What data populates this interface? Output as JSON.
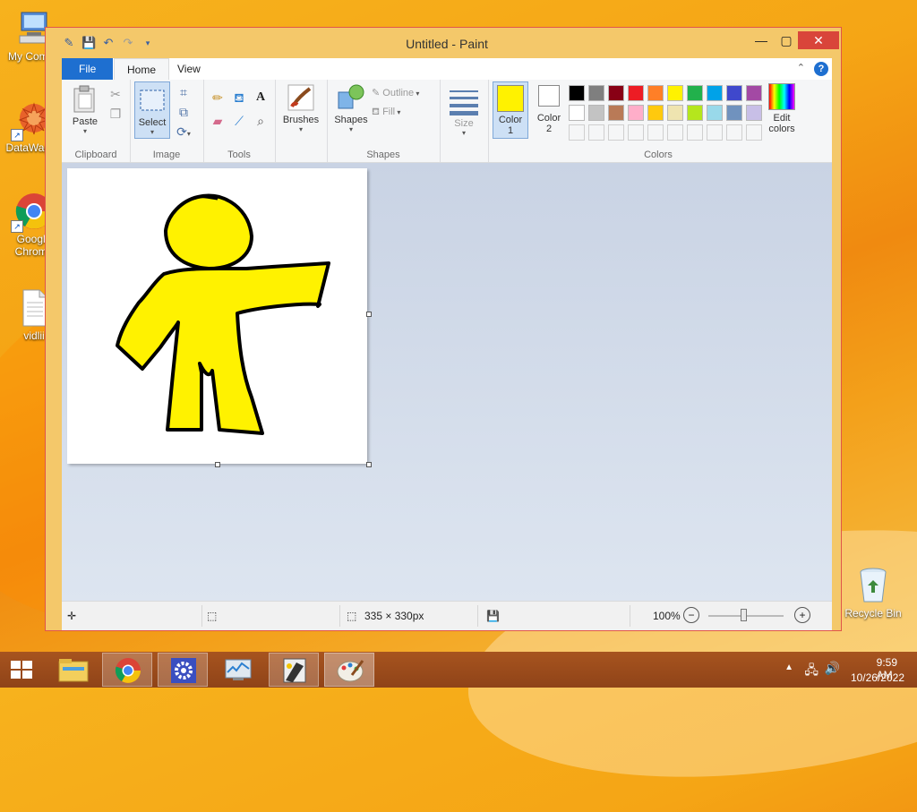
{
  "desktop": {
    "icons": [
      {
        "label": "My Compu",
        "icon": "computer-icon"
      },
      {
        "label": "DataWagon",
        "icon": "datawagon-icon"
      },
      {
        "label": "Google Chrome",
        "icon": "chrome-icon"
      },
      {
        "label": "vidlii",
        "icon": "text-file-icon"
      },
      {
        "label": "Recycle Bin",
        "icon": "recycle-bin-icon"
      }
    ]
  },
  "window": {
    "title": "Untitled - Paint",
    "controls": {
      "minimize": "—",
      "maximize": "▢",
      "close": "✕"
    }
  },
  "menu": {
    "file": "File",
    "home": "Home",
    "view": "View",
    "help": "?"
  },
  "ribbon": {
    "clipboard": {
      "label": "Clipboard",
      "paste": "Paste"
    },
    "image": {
      "label": "Image",
      "select": "Select"
    },
    "tools": {
      "label": "Tools"
    },
    "brushes": {
      "label": "Brushes"
    },
    "shapes": {
      "label": "Shapes",
      "shapes_btn": "Shapes",
      "outline": "Outline",
      "fill": "Fill"
    },
    "size": {
      "label": "Size"
    },
    "colors": {
      "label": "Colors",
      "color1": "Color",
      "color1_num": "1",
      "color2": "Color",
      "color2_num": "2",
      "edit1": "Edit",
      "edit2": "colors",
      "color1_value": "#FFF200",
      "color2_value": "#FFFFFF",
      "palette_row1": [
        "#000000",
        "#7F7F7F",
        "#880015",
        "#ED1C24",
        "#FF7F27",
        "#FFF200",
        "#22B14C",
        "#00A2E8",
        "#3F48CC",
        "#A349A4"
      ],
      "palette_row2": [
        "#FFFFFF",
        "#C3C3C3",
        "#B97A57",
        "#FFAEC9",
        "#FFC90E",
        "#EFE4B0",
        "#B5E61D",
        "#99D9EA",
        "#7092BE",
        "#C8BFE7"
      ]
    }
  },
  "status": {
    "canvas_size": "335 × 330px",
    "zoom": "100%"
  },
  "taskbar": {
    "apps": [
      "file-explorer-icon",
      "chrome-icon",
      "settings-icon",
      "performance-monitor-icon",
      "media-tool-icon",
      "paint-icon"
    ],
    "time": "9:59 AM",
    "date": "10/26/2022"
  },
  "drawing": {
    "fill": "#FFF200",
    "stroke": "#000000"
  }
}
